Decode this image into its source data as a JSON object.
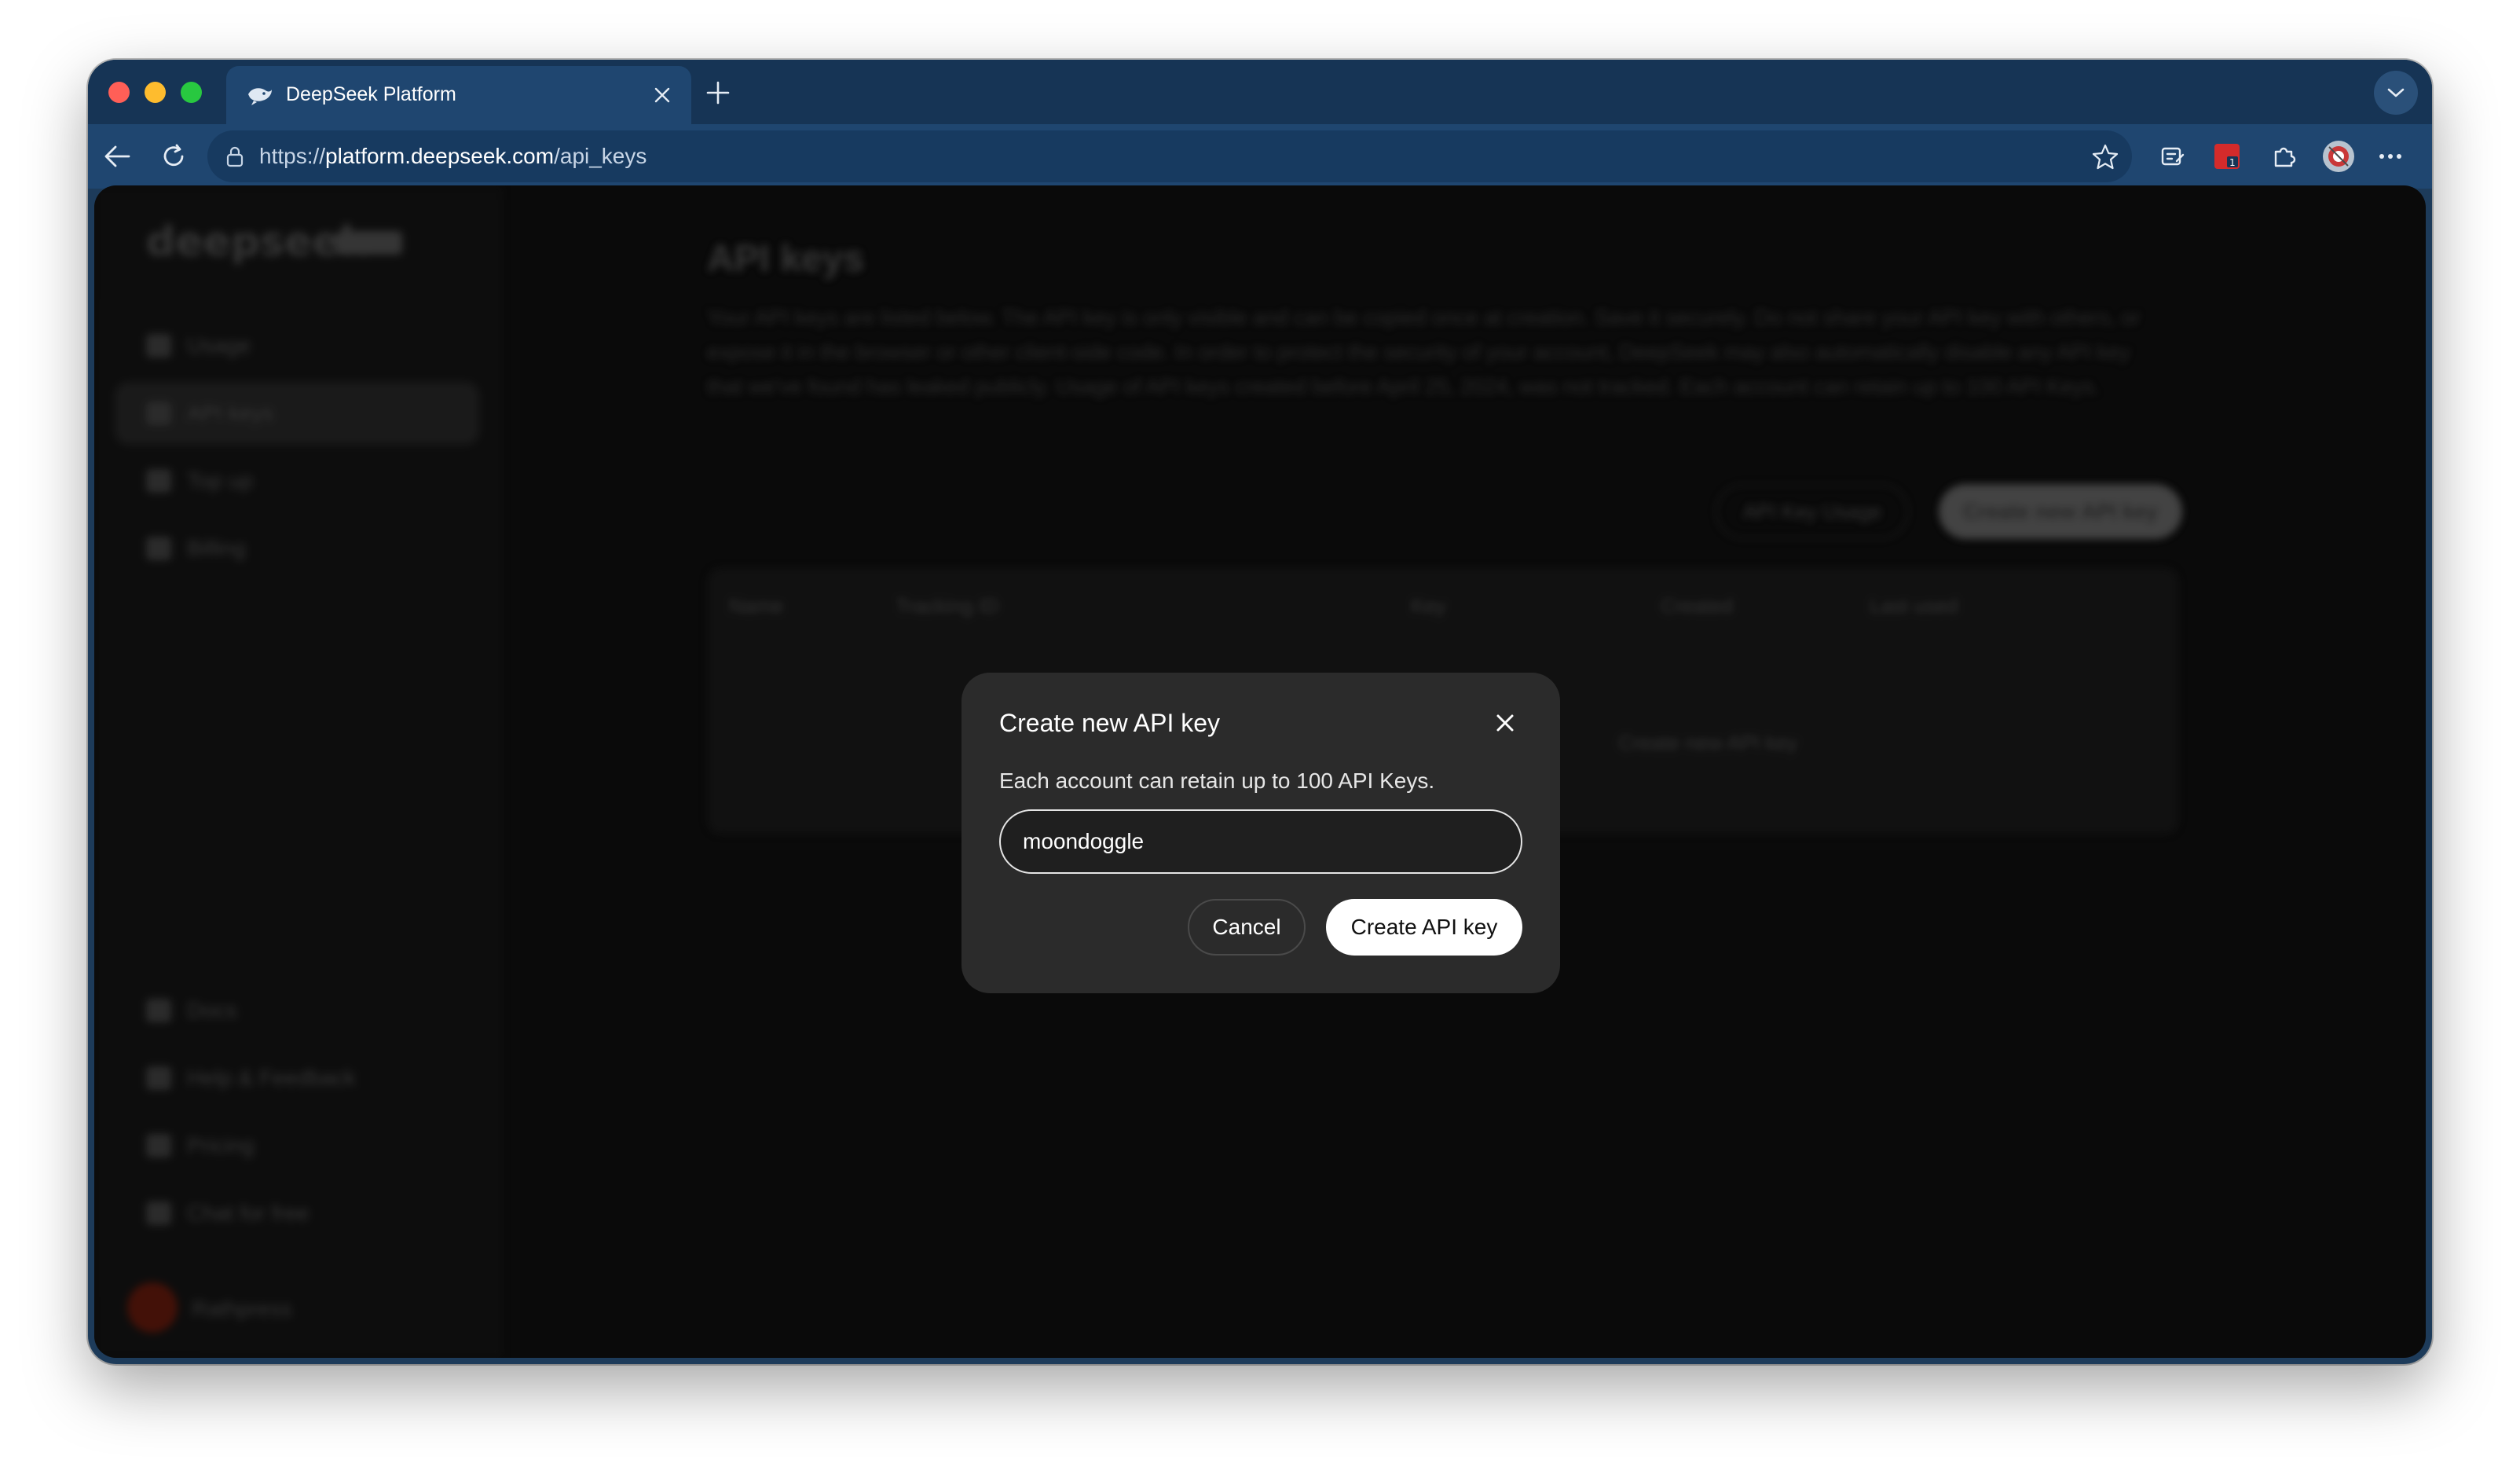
{
  "browser": {
    "tab_title": "DeepSeek Platform",
    "new_tab_symbol": "+",
    "url_scheme": "https://",
    "url_host": "platform.deepseek.com",
    "url_path": "/api_keys"
  },
  "sidebar": {
    "logo": "deepseek",
    "items": [
      {
        "label": "Usage",
        "icon": "bar-chart-icon"
      },
      {
        "label": "API keys",
        "icon": "search-icon"
      },
      {
        "label": "Top up",
        "icon": "wallet-icon"
      },
      {
        "label": "Billing",
        "icon": "billing-icon"
      }
    ],
    "bottom_items": [
      {
        "label": "Docs",
        "icon": "doc-icon"
      },
      {
        "label": "Help & Feedback",
        "icon": "help-icon"
      },
      {
        "label": "Pricing",
        "icon": "tag-icon"
      },
      {
        "label": "Chat for free",
        "icon": "chat-icon"
      }
    ],
    "user_name": "Rathpress"
  },
  "main": {
    "title": "API keys",
    "description": "Your API keys are listed below. The API key is only visible and can be copied once at creation. Save it securely. Do not share your API key with others, or expose it in the browser or other client-side code. In order to protect the security of your account, DeepSeek may also automatically disable any API key that we've found has leaked publicly. Usage of API keys created before April 25, 2024, was not tracked. Each account can retain up to 100 API Keys.",
    "usage_button": "API Key Usage",
    "create_button": "Create new API key",
    "table_headers": [
      "Name",
      "Tracking ID",
      "Key",
      "Created",
      "Last used"
    ],
    "empty_text": "Create new API key"
  },
  "modal": {
    "title": "Create new API key",
    "description": "Each account can retain up to 100 API Keys.",
    "input_value": "moondoggle",
    "cancel_label": "Cancel",
    "create_label": "Create API key"
  },
  "colors": {
    "browser_frame": "#163455",
    "modal_bg": "#2b2b2b",
    "primary_button": "#ffffff"
  }
}
